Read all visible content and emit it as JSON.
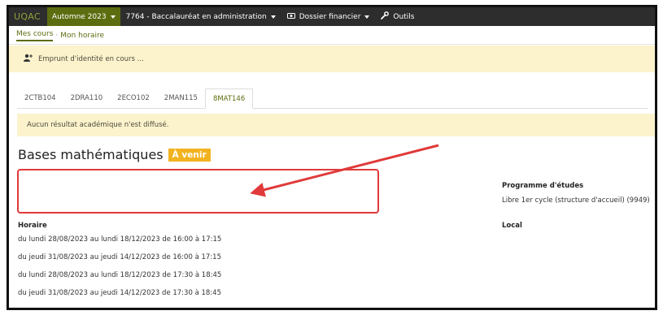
{
  "nav": {
    "brand": "UQAC",
    "term": "Automne 2023",
    "program": "7764 - Baccalauréat en administration",
    "finance": "Dossier financier",
    "tools": "Outils"
  },
  "breadcrumb": {
    "courses": "Mes cours",
    "schedule": "Mon horaire"
  },
  "impersonation_notice": "Emprunt d'identité en cours ...",
  "tabs": [
    "2CTB104",
    "2DRA110",
    "2ECO102",
    "2MAN115",
    "8MAT146"
  ],
  "active_tab": "8MAT146",
  "info_notice": "Aucun résultat académique n'est diffusé.",
  "course": {
    "title": "Bases mathématiques",
    "status": "À venir"
  },
  "program": {
    "label": "Programme d'études",
    "value": "Libre 1er cycle (structure d'accueil) (9949)"
  },
  "local_label": "Local",
  "horaire": {
    "label": "Horaire",
    "rows": [
      "du lundi 28/08/2023 au lundi 18/12/2023 de 16:00 à 17:15",
      "du jeudi 31/08/2023 au jeudi 14/12/2023 de 16:00 à 17:15",
      "du lundi 28/08/2023 au lundi 18/12/2023 de 17:30 à 18:45",
      "du jeudi 31/08/2023 au jeudi 14/12/2023 de 17:30 à 18:45"
    ]
  },
  "colors": {
    "nav_bg": "#2d2d2d",
    "accent": "#5b6d0f",
    "brand": "#8ea23a",
    "banner": "#fcf3cd",
    "badge": "#f2b320",
    "annotation": "#e03a3a"
  }
}
